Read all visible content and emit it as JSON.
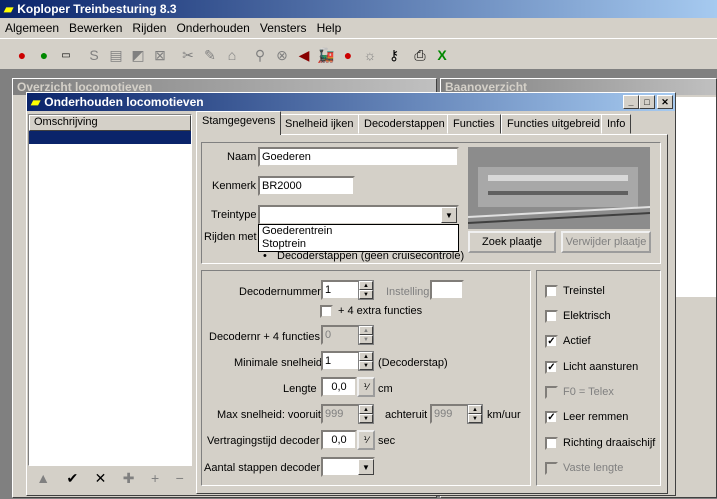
{
  "app": {
    "title": "Koploper Treinbesturing 8.3"
  },
  "menu": [
    "Algemeen",
    "Bewerken",
    "Rijden",
    "Onderhouden",
    "Vensters",
    "Help"
  ],
  "bg_windows": {
    "overview_title": "Overzicht locomotieven",
    "track_title": "Baanoverzicht"
  },
  "dialog": {
    "title": "Onderhouden locomotieven",
    "list_header": "Omschrijving",
    "tabs": [
      "Stamgegevens",
      "Snelheid ijken",
      "Decoderstappen",
      "Functies",
      "Functies uitgebreid",
      "Info"
    ],
    "form": {
      "naam_label": "Naam",
      "naam_value": "Goederen",
      "kenmerk_label": "Kenmerk",
      "kenmerk_value": "BR2000",
      "treintype_label": "Treintype",
      "treintype_value": "",
      "treintype_options": [
        "Goederentrein",
        "Stoptrein"
      ],
      "rijden_met_label": "Rijden met",
      "rijden_met_option": "Decoderstappen (geen cruisecontrole)",
      "zoek_button": "Zoek plaatje",
      "verwijder_button": "Verwijder plaatje"
    },
    "decoder": {
      "decodernummer_label": "Decodernummer",
      "decodernummer_value": "1",
      "instelling_label": "Instelling",
      "instelling_value": "",
      "extra_functies_label": "+ 4 extra functies",
      "decodernr4_label": "Decodernr + 4 functies",
      "decodernr4_value": "0",
      "min_snelheid_label": "Minimale snelheid",
      "min_snelheid_value": "1",
      "decoderstap_label": "(Decoderstap)",
      "lengte_label": "Lengte",
      "lengte_value": "0,0",
      "lengte_unit": "cm",
      "max_snelheid_label": "Max snelheid: vooruit",
      "max_vooruit_value": "999",
      "achteruit_label": "achteruit",
      "max_achteruit_value": "999",
      "speed_unit": "km/uur",
      "vertraging_label": "Vertragingstijd decoder",
      "vertraging_value": "0,0",
      "vertraging_unit": "sec",
      "aantal_label": "Aantal stappen decoder",
      "aantal_value": ""
    },
    "checkboxes": [
      {
        "label": "Treinstel",
        "checked": false,
        "disabled": false
      },
      {
        "label": "Elektrisch",
        "checked": false,
        "disabled": false
      },
      {
        "label": "Actief",
        "checked": true,
        "disabled": false
      },
      {
        "label": "Licht aansturen",
        "checked": true,
        "disabled": false
      },
      {
        "label": "F0 = Telex",
        "checked": false,
        "disabled": true
      },
      {
        "label": "Leer remmen",
        "checked": true,
        "disabled": false
      },
      {
        "label": "Richting draaischijf",
        "checked": false,
        "disabled": false
      },
      {
        "label": "Vaste lengte",
        "checked": false,
        "disabled": true
      }
    ]
  },
  "colors": {
    "titlebar": "#0a246a",
    "face": "#d4d0c8",
    "selection": "#0a246a"
  }
}
